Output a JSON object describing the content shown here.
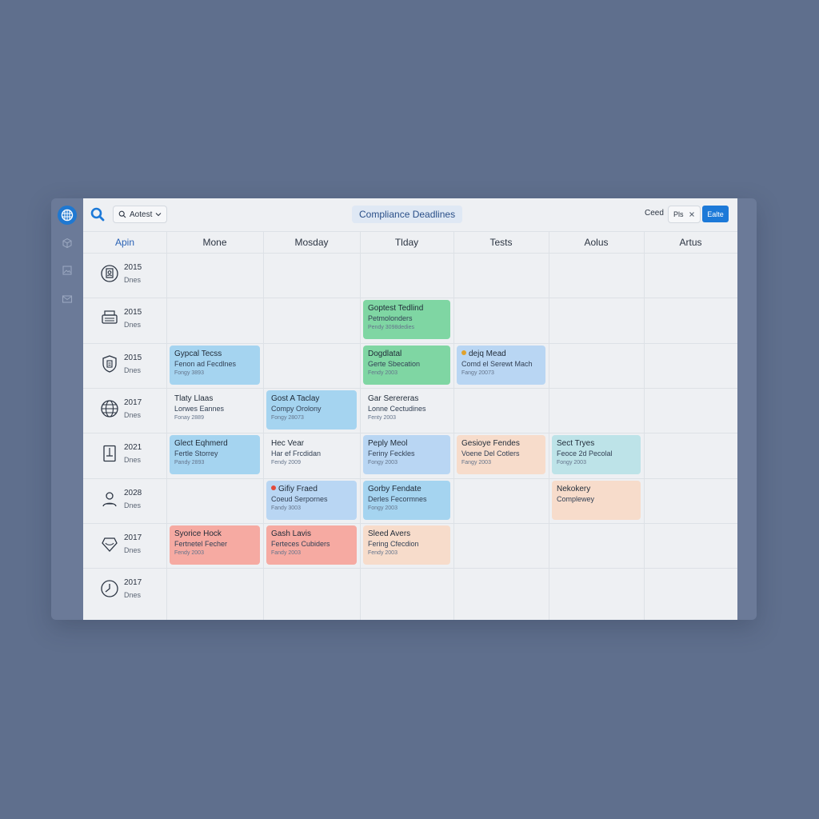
{
  "toolbar": {
    "filter_label": "Aotest",
    "title": "Compliance Deadlines",
    "right_text": "Ceed",
    "chip_label": "Pls",
    "primary_button": "Ealte"
  },
  "columns": [
    "Apin",
    "Mone",
    "Mosday",
    "Tlday",
    "Tests",
    "Aolus",
    "Artus"
  ],
  "rows": [
    {
      "year": "2015",
      "sub": "Dnes",
      "icon": "clipboard-user-icon"
    },
    {
      "year": "2015",
      "sub": "Dnes",
      "icon": "printer-icon"
    },
    {
      "year": "2015",
      "sub": "Dnes",
      "icon": "shield-document-icon"
    },
    {
      "year": "2017",
      "sub": "Dnes",
      "icon": "globe-icon"
    },
    {
      "year": "2021",
      "sub": "Dnes",
      "icon": "document-icon"
    },
    {
      "year": "2028",
      "sub": "Dnes",
      "icon": "user-icon"
    },
    {
      "year": "2017",
      "sub": "Dnes",
      "icon": "shield-icon"
    },
    {
      "year": "2017",
      "sub": "Dnes",
      "icon": "clock-icon"
    }
  ],
  "events": [
    {
      "row": 1,
      "col": 3,
      "color": "green",
      "title": "Goptest Tedlind",
      "subtitle": "Petmolonders",
      "date": "Pendy 3098dedies"
    },
    {
      "row": 2,
      "col": 1,
      "color": "blue",
      "title": "Gypcal Tecss",
      "subtitle": "Fenon ad Fecdlnes",
      "date": "Fongy 3893"
    },
    {
      "row": 2,
      "col": 3,
      "color": "green",
      "title": "Dogdlatal",
      "subtitle": "Gerte Sbecation",
      "date": "Fendy 2003"
    },
    {
      "row": 2,
      "col": 4,
      "color": "lblue",
      "title": "dejq Mead",
      "subtitle": "Comd el Serewt Mach",
      "date": "Fangy 20073",
      "dot": "#e0a12c"
    },
    {
      "row": 3,
      "col": 1,
      "color": "plain",
      "title": "Tlaty Llaas",
      "subtitle": "Lorwes Eannes",
      "date": "Fonay 2889"
    },
    {
      "row": 3,
      "col": 2,
      "color": "blue",
      "title": "Gost A Taclay",
      "subtitle": "Compy Orolony",
      "date": "Fongy 28073"
    },
    {
      "row": 3,
      "col": 3,
      "color": "plain",
      "title": "Gar Serereras",
      "subtitle": "Lonne Cectudines",
      "date": "Fenty 2003"
    },
    {
      "row": 4,
      "col": 1,
      "color": "blue",
      "title": "Glect Eqhmerd",
      "subtitle": "Fertle Storrey",
      "date": "Pandy 2893"
    },
    {
      "row": 4,
      "col": 2,
      "color": "plain",
      "title": "Hec Vear",
      "subtitle": "Har ef Frcdidan",
      "date": "Fendy 2009"
    },
    {
      "row": 4,
      "col": 3,
      "color": "lblue",
      "title": "Peply Meol",
      "subtitle": "Feriny Feckles",
      "date": "Fongy 2003"
    },
    {
      "row": 4,
      "col": 4,
      "color": "peach",
      "title": "Gesioye Fendes",
      "subtitle": "Voene Del Cotlers",
      "date": "Fangy 2003"
    },
    {
      "row": 4,
      "col": 5,
      "color": "teal",
      "title": "Sect Tryes",
      "subtitle": "Feoce 2d Pecolal",
      "date": "Fongy 2003"
    },
    {
      "row": 5,
      "col": 2,
      "color": "lblue",
      "title": "Gifiy Fraed",
      "subtitle": "Coeud Serpornes",
      "date": "Fandy 3003",
      "dot": "#e24a3b"
    },
    {
      "row": 5,
      "col": 3,
      "color": "blue",
      "title": "Gorby Fendate",
      "subtitle": "Derles Fecormnes",
      "date": "Fongy 2003"
    },
    {
      "row": 5,
      "col": 5,
      "color": "peach",
      "title": "Nekokery",
      "subtitle": "Complewey",
      "date": ""
    },
    {
      "row": 6,
      "col": 1,
      "color": "red",
      "title": "Syorice Hock",
      "subtitle": "Fertnetel Fecher",
      "date": "Fendy 2003"
    },
    {
      "row": 6,
      "col": 2,
      "color": "red",
      "title": "Gash Lavis",
      "subtitle": "Ferteces Cubiders",
      "date": "Fandy 2003"
    },
    {
      "row": 6,
      "col": 3,
      "color": "peach",
      "title": "Sleed Avers",
      "subtitle": "Fering Cfecdion",
      "date": "Fendy 2003"
    }
  ],
  "sidebar_icons": [
    "grid-logo-icon",
    "cube-icon",
    "image-icon",
    "mail-icon"
  ]
}
